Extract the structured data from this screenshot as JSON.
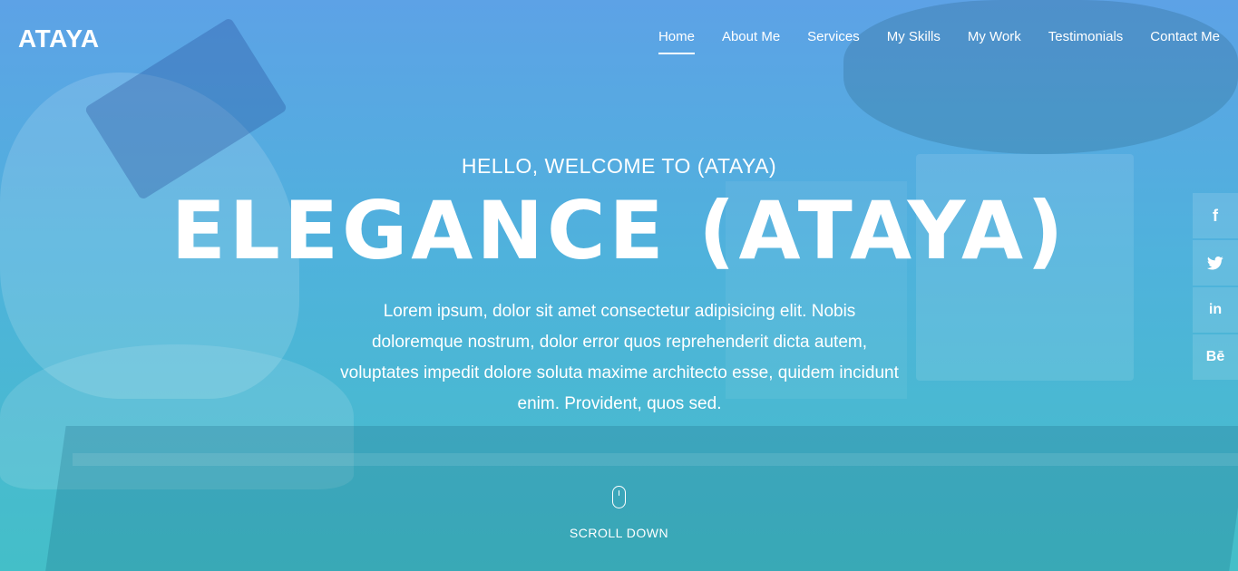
{
  "header": {
    "logo": "ATAYA",
    "nav": [
      {
        "label": "Home",
        "active": true
      },
      {
        "label": "About Me",
        "active": false
      },
      {
        "label": "Services",
        "active": false
      },
      {
        "label": "My Skills",
        "active": false
      },
      {
        "label": "My Work",
        "active": false
      },
      {
        "label": "Testimonials",
        "active": false
      },
      {
        "label": "Contact Me",
        "active": false
      }
    ]
  },
  "hero": {
    "subtitle": "HELLO, WELCOME TO (ATAYA)",
    "headline": "ELEGANCE (ATAYA)",
    "paragraph": "Lorem ipsum, dolor sit amet consectetur adipisicing elit. Nobis doloremque nostrum, dolor error quos reprehenderit dicta autem, voluptates impedit dolore soluta maxime architecto esse, quidem incidunt enim. Provident, quos sed.",
    "scroll_label": "SCROLL DOWN",
    "scroll_icon": "mouse-icon"
  },
  "social": [
    {
      "icon": "facebook-icon",
      "glyph": "f"
    },
    {
      "icon": "twitter-icon",
      "glyph": ""
    },
    {
      "icon": "linkedin-icon",
      "glyph": "in"
    },
    {
      "icon": "behance-icon",
      "glyph": "Bē"
    }
  ],
  "colors": {
    "gradient_top": "#5da2e6",
    "gradient_bottom": "#44bfc8",
    "text": "#ffffff"
  }
}
